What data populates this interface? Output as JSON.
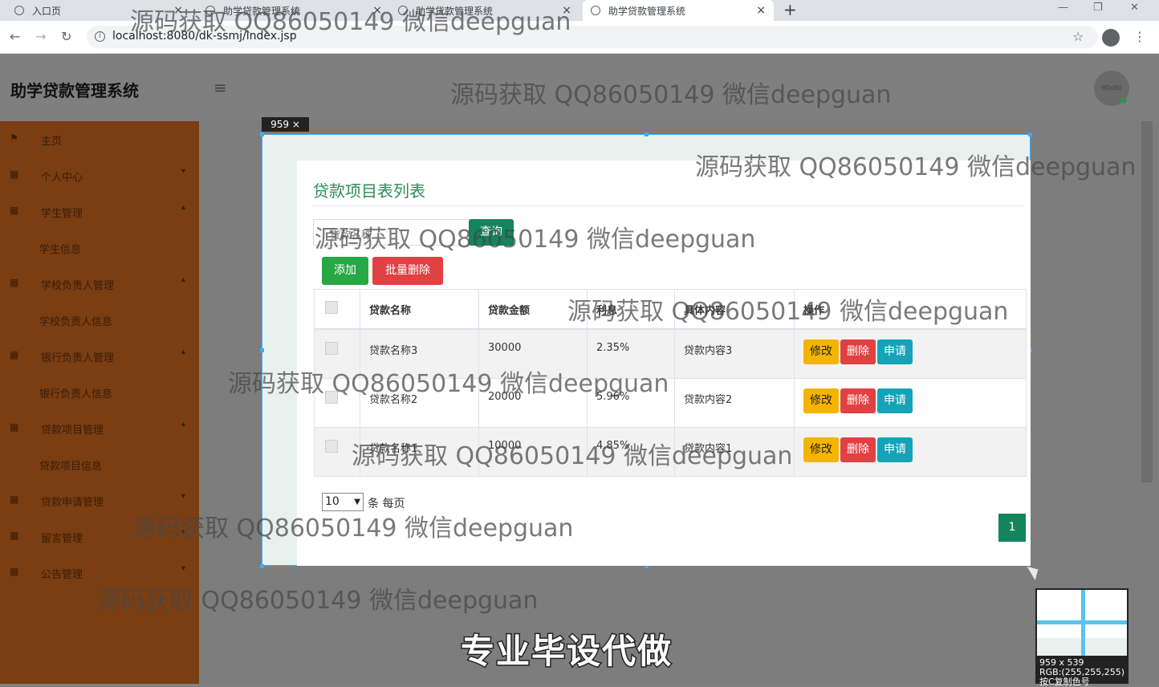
{
  "browser": {
    "tabs": [
      {
        "title": "入口页"
      },
      {
        "title": "助学贷款管理系统"
      },
      {
        "title": "助学贷款管理系统"
      },
      {
        "title": "助学贷款管理系统"
      }
    ],
    "url": "localhost:8080/dk-ssmj/index.jsp"
  },
  "header": {
    "brand": "助学贷款管理系统",
    "avatar_text": "80x80"
  },
  "sidebar": {
    "items": [
      {
        "label": "主页",
        "icon": "flag-icon",
        "type": "top"
      },
      {
        "label": "个人中心",
        "icon": "grid-icon",
        "type": "top",
        "caret": "▾"
      },
      {
        "label": "学生管理",
        "icon": "grid-icon",
        "type": "top",
        "caret": "▴"
      },
      {
        "label": "学生信息",
        "type": "sub"
      },
      {
        "label": "学校负责人管理",
        "icon": "grid-icon",
        "type": "top",
        "caret": "▴"
      },
      {
        "label": "学校负责人信息",
        "type": "sub"
      },
      {
        "label": "银行负责人管理",
        "icon": "grid-icon",
        "type": "top",
        "caret": "▴"
      },
      {
        "label": "银行负责人信息",
        "type": "sub"
      },
      {
        "label": "贷款项目管理",
        "icon": "grid-icon",
        "type": "top",
        "caret": "▴"
      },
      {
        "label": "贷款项目信息",
        "type": "sub"
      },
      {
        "label": "贷款申请管理",
        "icon": "grid-icon",
        "type": "top",
        "caret": "▾"
      },
      {
        "label": "留言管理",
        "icon": "grid-icon",
        "type": "top",
        "caret": "▾"
      },
      {
        "label": "公告管理",
        "icon": "grid-icon",
        "type": "top",
        "caret": "▾"
      }
    ]
  },
  "screenshot_tool": {
    "size_label": "959 × 539",
    "magnifier_size": "959 x 539",
    "magnifier_rgb": "RGB:(255,255,255)",
    "magnifier_hint": "按C复制色号"
  },
  "main": {
    "title": "贷款项目表列表",
    "search_placeholder": "贷款名称",
    "query_label": "查询",
    "add_label": "添加",
    "batch_delete_label": "批量删除",
    "columns": [
      "贷款名称",
      "贷款金额",
      "利息",
      "具体内容",
      "操作"
    ],
    "rows": [
      {
        "name": "贷款名称3",
        "amount": "30000",
        "interest": "2.35%",
        "content": "贷款内容3"
      },
      {
        "name": "贷款名称2",
        "amount": "20000",
        "interest": "5.96%",
        "content": "贷款内容2"
      },
      {
        "name": "贷款名称1",
        "amount": "10000",
        "interest": "4.85%",
        "content": "贷款内容1"
      }
    ],
    "row_actions": {
      "edit": "修改",
      "delete": "删除",
      "apply": "申请"
    },
    "page_size": "10",
    "per_page_label": "条 每页",
    "current_page": "1"
  },
  "overlay": {
    "watermark": "源码获取 QQ86050149 微信deepguan",
    "caption": "专业毕设代做"
  }
}
